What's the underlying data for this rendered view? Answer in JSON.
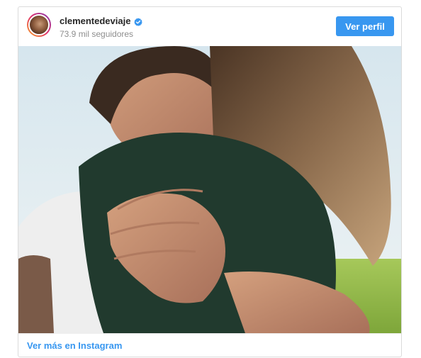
{
  "profile": {
    "username": "clementedeviaje",
    "followers": "73.9 mil seguidores",
    "verified": true,
    "button_label": "Ver perfil",
    "avatar_icon": "profile-avatar"
  },
  "post": {
    "image_icon": "photo"
  },
  "footer": {
    "link_label": "Ver más en Instagram"
  },
  "colors": {
    "accent": "#3897f0",
    "username": "#262626",
    "secondary_text": "#8e8e8e",
    "border": "#dbdbdb"
  }
}
